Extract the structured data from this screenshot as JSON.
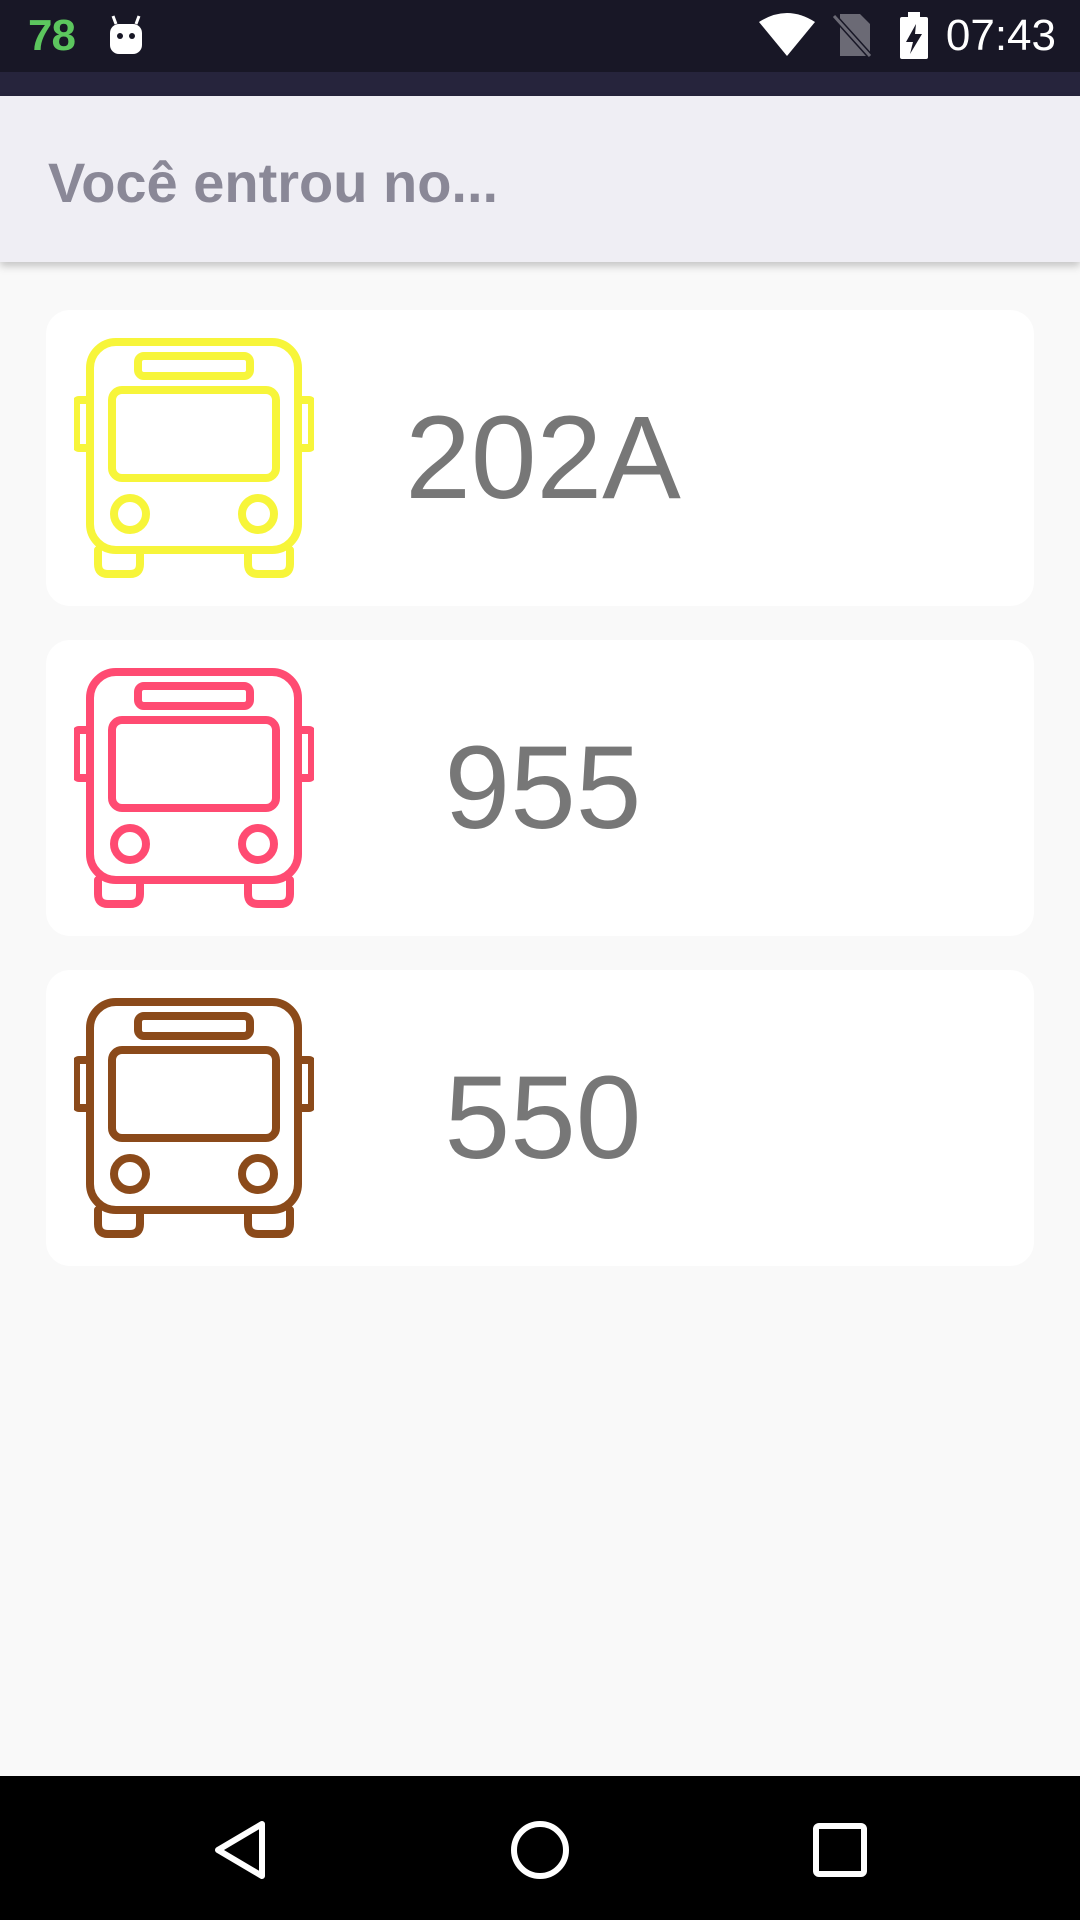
{
  "status_bar": {
    "left_badge": "78",
    "left_badge_color": "#5cc65e",
    "time": "07:43",
    "icons": [
      "android-icon",
      "wifi-icon",
      "no-sim-icon",
      "battery-charging-icon"
    ]
  },
  "app_bar": {
    "title": "Você entrou no..."
  },
  "buses": [
    {
      "number": "202A",
      "icon": "bus-icon",
      "color": "#f7f53a"
    },
    {
      "number": "955",
      "icon": "bus-icon",
      "color": "#ff4b72"
    },
    {
      "number": "550",
      "icon": "bus-icon",
      "color": "#8b4a1a"
    }
  ],
  "nav_bar": {
    "buttons": [
      "back-icon",
      "home-icon",
      "recents-icon"
    ]
  }
}
